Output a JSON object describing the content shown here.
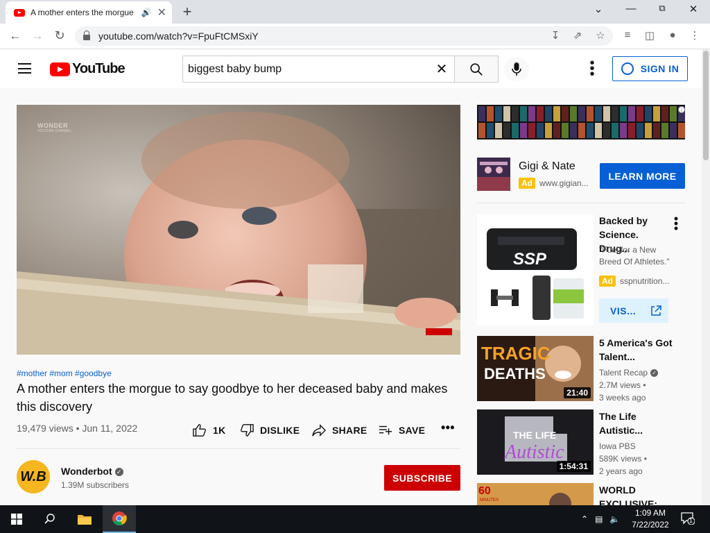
{
  "browser": {
    "tab_title": "A mother enters the morgue",
    "url": "youtube.com/watch?v=FpuFtCMSxiY"
  },
  "youtube": {
    "logo_text": "YouTube",
    "search_value": "biggest baby bump",
    "sign_in": "SIGN IN"
  },
  "video": {
    "watermark": "WONDER",
    "watermark_sub": "YOUTUBE CHANNEL",
    "hashtags": "#mother #mom #goodbye",
    "title": "A mother enters the morgue to say goodbye to her deceased baby and makes this discovery",
    "views_date": "19,479 views • Jun 11, 2022",
    "likes": "1K",
    "dislike": "DISLIKE",
    "share": "SHARE",
    "save": "SAVE",
    "channel": {
      "avatar_text": "W.B",
      "name": "Wonderbot",
      "subscribers": "1.39M subscribers",
      "subscribe": "SUBSCRIBE"
    }
  },
  "sidebar": {
    "ad1": {
      "name": "Gigi & Nate",
      "badge": "Ad",
      "url": "www.gigian...",
      "cta": "LEARN MORE"
    },
    "ad2": {
      "title": "Backed by Science. Drug...",
      "desc": "\"Fuel for a New Breed Of Athletes.\"",
      "badge": "Ad",
      "url": "sspnutrition...",
      "cta": "VIS...",
      "product_label": "SSP"
    },
    "videos": [
      {
        "title": "5 America's Got Talent...",
        "channel": "Talent Recap",
        "views": "2.7M views •",
        "age": "3 weeks ago",
        "duration": "21:40",
        "thumb_text1": "TRAGIC",
        "thumb_text2": "DEATHS"
      },
      {
        "title": "The Life Autistic...",
        "channel": "Iowa PBS",
        "views": "589K views •",
        "age": "2 years ago",
        "duration": "1:54:31",
        "thumb_text1": "THE LIFE",
        "thumb_text2": "Autistic"
      },
      {
        "title": "WORLD EXCLUSIVE:",
        "channel": "",
        "views": "",
        "age": "",
        "duration": "",
        "thumb_text1": "60",
        "thumb_text2": "MINUTES"
      }
    ]
  },
  "taskbar": {
    "time": "1:09 AM",
    "date": "7/22/2022",
    "notifications": "1"
  },
  "colors": {
    "youtube_red": "#ff0000",
    "link_blue": "#065fd4",
    "subscribe_red": "#cc0000",
    "ad_yellow": "#f9c10b"
  }
}
